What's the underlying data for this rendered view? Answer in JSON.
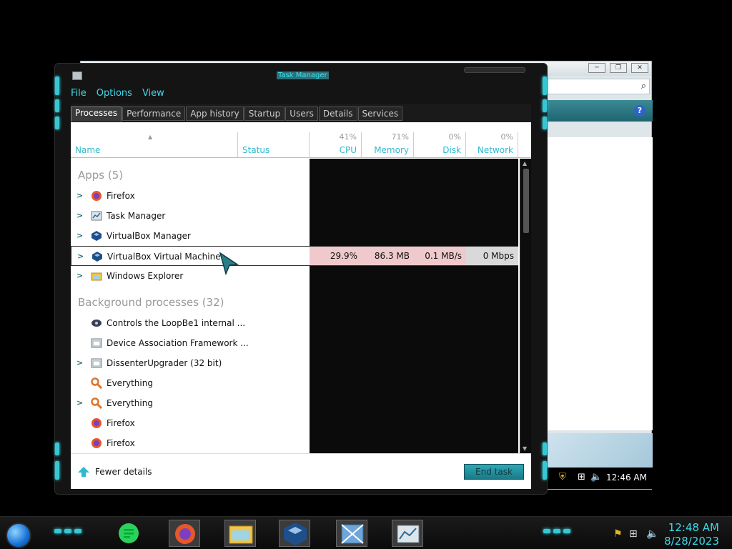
{
  "window": {
    "title": "Task Manager"
  },
  "menu": {
    "file": "File",
    "options": "Options",
    "view": "View"
  },
  "tabs": [
    "Processes",
    "Performance",
    "App history",
    "Startup",
    "Users",
    "Details",
    "Services"
  ],
  "columns": {
    "name": "Name",
    "status": "Status",
    "cpu": {
      "label": "CPU",
      "pct": "41%"
    },
    "memory": {
      "label": "Memory",
      "pct": "71%"
    },
    "disk": {
      "label": "Disk",
      "pct": "0%"
    },
    "network": {
      "label": "Network",
      "pct": "0%"
    }
  },
  "groups": {
    "apps": "Apps (5)",
    "background": "Background processes (32)"
  },
  "apps": [
    {
      "name": "Firefox",
      "icon": "firefox-icon"
    },
    {
      "name": "Task Manager",
      "icon": "task-manager-icon"
    },
    {
      "name": "VirtualBox Manager",
      "icon": "virtualbox-icon"
    },
    {
      "name": "VirtualBox Virtual Machine",
      "icon": "virtualbox-icon",
      "cpu": "29.9%",
      "memory": "86.3 MB",
      "disk": "0.1 MB/s",
      "network": "0 Mbps"
    },
    {
      "name": "Windows Explorer",
      "icon": "explorer-icon"
    }
  ],
  "background": [
    {
      "name": "Controls the LoopBe1 internal ...",
      "icon": "loopbe-icon"
    },
    {
      "name": "Device Association Framework ...",
      "icon": "service-window-icon"
    },
    {
      "name": "DissenterUpgrader (32 bit)",
      "icon": "service-window-icon"
    },
    {
      "name": "Everything",
      "icon": "everything-search-icon"
    },
    {
      "name": "Everything",
      "icon": "everything-search-icon"
    },
    {
      "name": "Firefox",
      "icon": "firefox-icon"
    },
    {
      "name": "Firefox",
      "icon": "firefox-icon"
    }
  ],
  "footer": {
    "fewer_details": "Fewer details",
    "end_task": "End task"
  },
  "bg_tray": {
    "time": "12:46 AM"
  },
  "taskbar": {
    "time": "12:48 AM",
    "date": "8/28/2023"
  },
  "colors": {
    "accent": "#39e2f0",
    "highlight": "#efc9cb",
    "button": "#2fa8b6"
  }
}
